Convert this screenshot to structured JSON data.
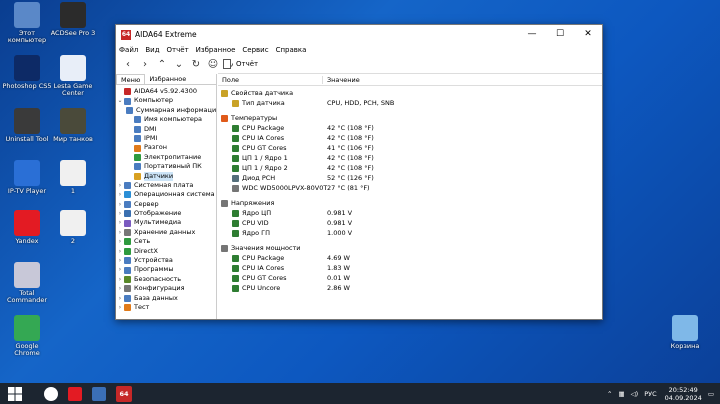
{
  "desktop": {
    "icons": [
      {
        "label": "Этот компьютер",
        "color": "#5a88c8"
      },
      {
        "label": "ACDSee Pro 3",
        "color": "#2b2b2b"
      },
      {
        "label": "Photoshop CS5",
        "color": "#0d2a66"
      },
      {
        "label": "Lesta Game Center",
        "color": "#e8eef8"
      },
      {
        "label": "Uninstall Tool",
        "color": "#3a3a3a"
      },
      {
        "label": "Мир танков",
        "color": "#4a4a3a"
      },
      {
        "label": "IP-TV Player",
        "color": "#2a6fd6"
      },
      {
        "label": "1",
        "color": "#f0f0f0"
      },
      {
        "label": "Yandex",
        "color": "#e31b23"
      },
      {
        "label": "2",
        "color": "#f0f0f0"
      },
      {
        "label": "Total Commander",
        "color": "#c8c8d8"
      },
      {
        "label": "Google Chrome",
        "color": "#34a853"
      },
      {
        "label": "Корзина",
        "color": "#7fb8e8"
      }
    ]
  },
  "window": {
    "title": "AIDA64 Extreme",
    "app_icon": "64",
    "controls": {
      "minimize": "—",
      "maximize": "☐",
      "close": "✕"
    },
    "menu": [
      "Файл",
      "Вид",
      "Отчёт",
      "Избранное",
      "Сервис",
      "Справка"
    ],
    "tabs": [
      "Меню",
      "Избранное"
    ],
    "report_button": "Отчёт",
    "tree": {
      "root": "AIDA64 v5.92.4300",
      "computer": "Компьютер",
      "computer_children": [
        "Суммарная информация",
        "Имя компьютера",
        "DMI",
        "IPMI",
        "Разгон",
        "Электропитание",
        "Портативный ПК",
        "Датчики"
      ],
      "sections": [
        "Системная плата",
        "Операционная система",
        "Сервер",
        "Отображение",
        "Мультимедиа",
        "Хранение данных",
        "Сеть",
        "DirectX",
        "Устройства",
        "Программы",
        "Безопасность",
        "Конфигурация",
        "База данных",
        "Тест"
      ]
    },
    "columns": {
      "field": "Поле",
      "value": "Значение"
    },
    "groups": [
      {
        "title": "Свойства датчика",
        "color": "#c9a227",
        "items": [
          {
            "field": "Тип датчика",
            "value": "CPU, HDD, PCH, SNB",
            "color": "#c9a227"
          }
        ]
      },
      {
        "title": "Температуры",
        "color": "#e05a1a",
        "items": [
          {
            "field": "CPU Package",
            "value": "42 °C  (108 °F)",
            "color": "#2e7d32"
          },
          {
            "field": "CPU IA Cores",
            "value": "42 °C  (108 °F)",
            "color": "#2e7d32"
          },
          {
            "field": "CPU GT Cores",
            "value": "41 °C  (106 °F)",
            "color": "#2e7d32"
          },
          {
            "field": "ЦП 1 / Ядро 1",
            "value": "42 °C  (108 °F)",
            "color": "#2e7d32"
          },
          {
            "field": "ЦП 1 / Ядро 2",
            "value": "42 °C  (108 °F)",
            "color": "#2e7d32"
          },
          {
            "field": "Диод PCH",
            "value": "52 °C  (126 °F)",
            "color": "#546e7a"
          },
          {
            "field": "WDC WD5000LPVX-80V0T...",
            "value": "27 °C  (81 °F)",
            "color": "#757575"
          }
        ]
      },
      {
        "title": "Напряжения",
        "color": "#757575",
        "items": [
          {
            "field": "Ядро ЦП",
            "value": "0.981 V",
            "color": "#2e7d32"
          },
          {
            "field": "CPU VID",
            "value": "0.981 V",
            "color": "#2e7d32"
          },
          {
            "field": "Ядро ГП",
            "value": "1.000 V",
            "color": "#2e7d32"
          }
        ]
      },
      {
        "title": "Значения мощности",
        "color": "#757575",
        "items": [
          {
            "field": "CPU Package",
            "value": "4.69 W",
            "color": "#2e7d32"
          },
          {
            "field": "CPU IA Cores",
            "value": "1.83 W",
            "color": "#2e7d32"
          },
          {
            "field": "CPU GT Cores",
            "value": "0.01 W",
            "color": "#2e7d32"
          },
          {
            "field": "CPU Uncore",
            "value": "2.86 W",
            "color": "#2e7d32"
          }
        ]
      }
    ]
  },
  "taskbar": {
    "language": "РУС",
    "time": "20:52:49",
    "date": "04.09.2024",
    "apps": [
      "yandex-browser",
      "yandex-y",
      "floppy-save",
      "aida64"
    ],
    "aida_label": "64"
  }
}
